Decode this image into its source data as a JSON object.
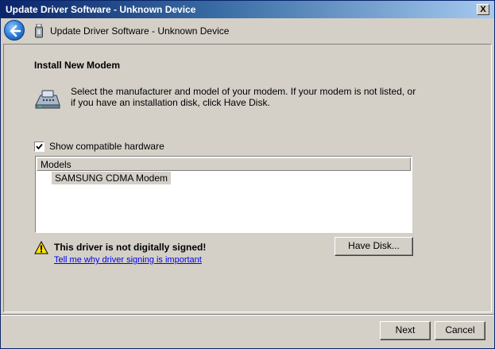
{
  "window": {
    "title": "Update Driver Software - Unknown Device",
    "close_label": "X"
  },
  "nav": {
    "title": "Update Driver Software - Unknown Device"
  },
  "content": {
    "heading": "Install New Modem",
    "instructions": "Select the manufacturer and model of your modem. If your modem is not listed, or if you have an installation disk, click Have Disk.",
    "show_compatible_label": "Show compatible hardware",
    "show_compatible_checked": true,
    "models": {
      "header": "Models",
      "items": [
        "SAMSUNG CDMA Modem"
      ]
    },
    "warning": {
      "title": "This driver is not digitally signed!",
      "link": "Tell me why driver signing is important"
    },
    "have_disk_label": "Have Disk..."
  },
  "footer": {
    "next_label": "Next",
    "cancel_label": "Cancel"
  },
  "icons": {
    "back": "back-arrow-icon",
    "device": "usb-device-icon",
    "modem": "modem-icon",
    "warning": "warning-icon",
    "check": "checkmark-icon"
  },
  "colors": {
    "title_start": "#0a246a",
    "title_end": "#a6caf0",
    "dialog_bg": "#d4d0c8",
    "link": "#0000ee"
  }
}
